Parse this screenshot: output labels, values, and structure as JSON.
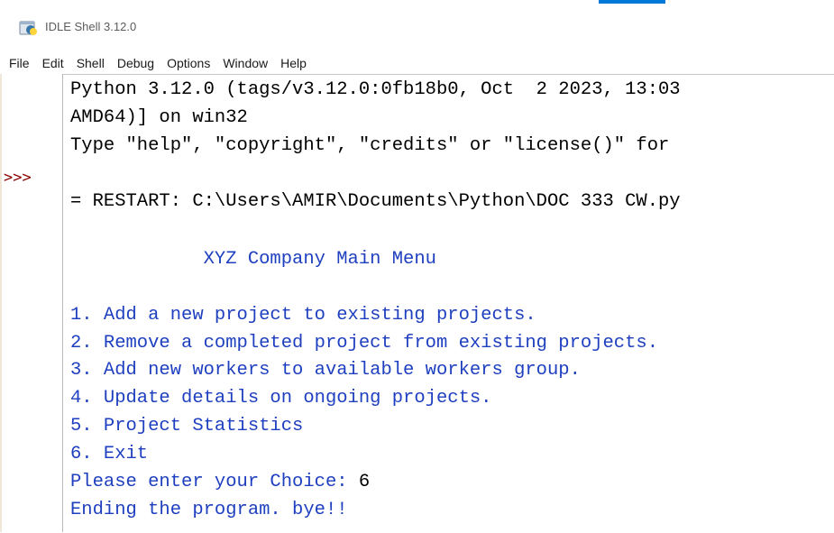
{
  "window": {
    "title": "IDLE Shell 3.12.0",
    "icon": "python-idle-icon"
  },
  "menu": [
    "File",
    "Edit",
    "Shell",
    "Debug",
    "Options",
    "Window",
    "Help"
  ],
  "shell": {
    "prompt": ">>>",
    "banner": [
      "Python 3.12.0 (tags/v3.12.0:0fb18b0, Oct  2 2023, 13:03",
      "AMD64)] on win32",
      "Type \"help\", \"copyright\", \"credits\" or \"license()\" for"
    ],
    "restart": "= RESTART: C:\\Users\\AMIR\\Documents\\Python\\DOC 333 CW.py",
    "output": [
      "            XYZ Company Main Menu",
      "",
      "1. Add a new project to existing projects.",
      "2. Remove a completed project from existing projects.",
      "3. Add new workers to available workers group.",
      "4. Update details on ongoing projects.",
      "5. Project Statistics",
      "6. Exit",
      "Please enter your Choice: ",
      "Ending the program. bye!!"
    ],
    "user_input": "6"
  },
  "colors": {
    "output_text": "#1e3fbf",
    "input_text": "#000000",
    "prompt": "#8b0000"
  }
}
